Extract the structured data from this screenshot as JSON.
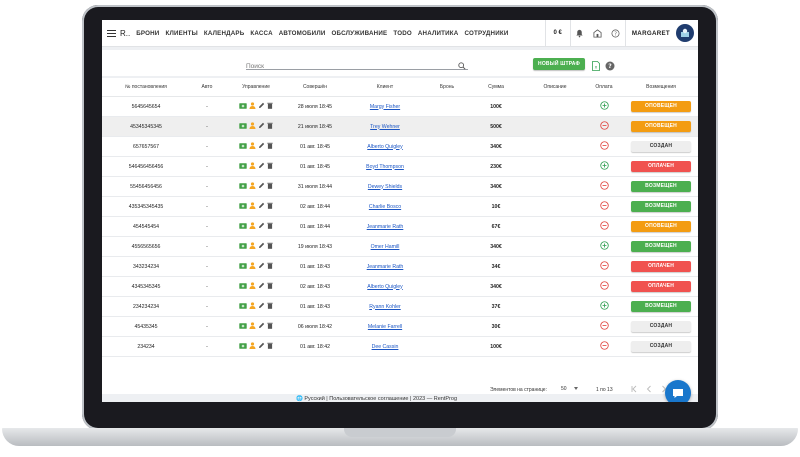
{
  "brand": "R..",
  "nav": [
    "БРОНИ",
    "КЛИЕНТЫ",
    "КАЛЕНДАРЬ",
    "КАССА",
    "АВТОМОБИЛИ",
    "ОБСЛУЖИВАНИЕ",
    "TODO",
    "АНАЛИТИКА",
    "СОТРУДНИКИ"
  ],
  "balance": "0 €",
  "user": "MARGARET",
  "search": {
    "placeholder": "Поиск"
  },
  "new_fine_button": "НОВЫЙ ШТРАФ",
  "columns": [
    "№ постановления",
    "Авто",
    "Управление",
    "Совершён",
    "Клиент",
    "Бронь",
    "Сумма",
    "Описание",
    "Оплата",
    "Возмещения"
  ],
  "colors": {
    "orange": "#f39c12",
    "red": "#f0524f",
    "green": "#4caf50",
    "grey": "#eeeeee",
    "accent": "#1977cc"
  },
  "rows": [
    {
      "num": "5645645654",
      "auto": "-",
      "date": "28 июля 18:45",
      "client": "Margy Fisher",
      "booking": "",
      "amount": "100€",
      "desc": "",
      "paid": true,
      "status": "ОПОВЕЩЕН",
      "status_color": "orange"
    },
    {
      "num": "45345345345",
      "auto": "-",
      "date": "21 июля 18:45",
      "client": "Trey Wehner",
      "booking": "",
      "amount": "500€",
      "desc": "",
      "paid": false,
      "status": "ОПОВЕЩЕН",
      "status_color": "orange"
    },
    {
      "num": "657657567",
      "auto": "-",
      "date": "01 авг. 18:45",
      "client": "Alberto Quigley",
      "booking": "",
      "amount": "340€",
      "desc": "",
      "paid": false,
      "status": "СОЗДАН",
      "status_color": "grey"
    },
    {
      "num": "546456456456",
      "auto": "-",
      "date": "01 авг. 18:45",
      "client": "Boyd Thompson",
      "booking": "",
      "amount": "230€",
      "desc": "",
      "paid": true,
      "status": "ОПЛАЧЕН",
      "status_color": "red"
    },
    {
      "num": "55456456456",
      "auto": "-",
      "date": "31 июля 18:44",
      "client": "Dewey Shields",
      "booking": "",
      "amount": "340€",
      "desc": "",
      "paid": false,
      "status": "ВОЗМЕЩЕН",
      "status_color": "green"
    },
    {
      "num": "435345345435",
      "auto": "-",
      "date": "02 авг. 18:44",
      "client": "Charlie Bosco",
      "booking": "",
      "amount": "10€",
      "desc": "",
      "paid": false,
      "status": "ВОЗМЕЩЕН",
      "status_color": "green"
    },
    {
      "num": "454545454",
      "auto": "-",
      "date": "01 авг. 18:44",
      "client": "Jeanmarie Rath",
      "booking": "",
      "amount": "67€",
      "desc": "",
      "paid": false,
      "status": "ОПОВЕЩЕН",
      "status_color": "orange"
    },
    {
      "num": "4556565656",
      "auto": "-",
      "date": "19 июля 18:43",
      "client": "Omer Hamill",
      "booking": "",
      "amount": "340€",
      "desc": "",
      "paid": true,
      "status": "ВОЗМЕЩЕН",
      "status_color": "green"
    },
    {
      "num": "343234234",
      "auto": "-",
      "date": "01 авг. 18:43",
      "client": "Jeanmarie Rath",
      "booking": "",
      "amount": "34€",
      "desc": "",
      "paid": false,
      "status": "ОПЛАЧЕН",
      "status_color": "red"
    },
    {
      "num": "4345345345",
      "auto": "-",
      "date": "02 авг. 18:43",
      "client": "Alberto Quigley",
      "booking": "",
      "amount": "340€",
      "desc": "",
      "paid": false,
      "status": "ОПЛАЧЕН",
      "status_color": "red"
    },
    {
      "num": "234234234",
      "auto": "-",
      "date": "01 авг. 18:43",
      "client": "Ryann Kohler",
      "booking": "",
      "amount": "37€",
      "desc": "",
      "paid": true,
      "status": "ВОЗМЕЩЕН",
      "status_color": "green"
    },
    {
      "num": "45435345",
      "auto": "-",
      "date": "06 июля 18:42",
      "client": "Melanie Farrell",
      "booking": "",
      "amount": "30€",
      "desc": "",
      "paid": false,
      "status": "СОЗДАН",
      "status_color": "grey"
    },
    {
      "num": "234234",
      "auto": "-",
      "date": "01 авг. 18:42",
      "client": "Dee Cassin",
      "booking": "",
      "amount": "100€",
      "desc": "",
      "paid": false,
      "status": "СОЗДАН",
      "status_color": "grey"
    }
  ],
  "pager": {
    "label": "Элементов на странице:",
    "per_page": "50",
    "range": "1 по 13"
  },
  "footer": {
    "text": "🌐 Русский    |  Пользовательское соглашение  |  2023 — RentProg"
  }
}
